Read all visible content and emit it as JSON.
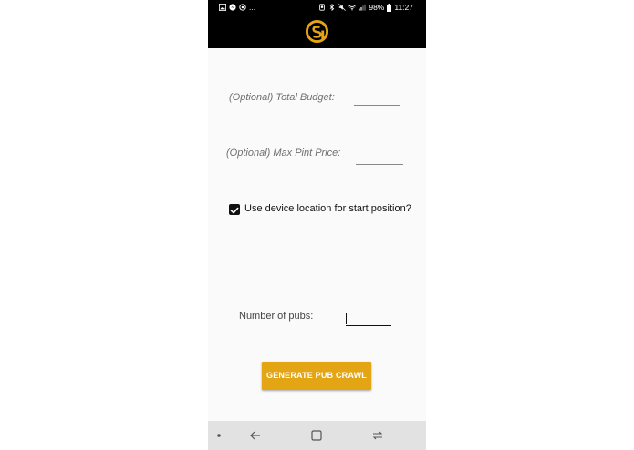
{
  "status_bar": {
    "left_icons": [
      "gallery-icon",
      "messenger-icon",
      "whatsapp-icon"
    ],
    "overflow": "...",
    "right_icons": [
      "alarm-icon",
      "bluetooth-icon",
      "mute-icon",
      "wifi-icon",
      "signal-icon"
    ],
    "battery": "98%",
    "time": "11:27"
  },
  "app_bar": {
    "logo": "app-logo",
    "brand_color": "#e3a514",
    "background": "#000000"
  },
  "form": {
    "total_budget_label": "(Optional) Total Budget:",
    "total_budget_value": "",
    "max_pint_label": "(Optional) Max Pint Price:",
    "max_pint_value": "",
    "use_location_label": "Use device location for start position?",
    "use_location_checked": true,
    "num_pubs_label": "Number of pubs:",
    "num_pubs_value": ""
  },
  "generate_button": {
    "label": "GENERATE PUB CRAWL",
    "color": "#e3a514"
  },
  "nav_bar": {
    "items": [
      "dot-icon",
      "back-icon",
      "home-icon",
      "recents-icon"
    ]
  }
}
